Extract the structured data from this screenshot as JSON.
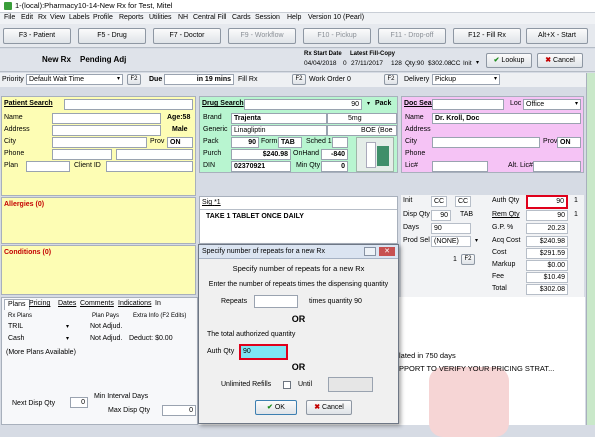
{
  "window": {
    "title": "1-(local):Pharmacy10-14-New Rx for Test, Mitel"
  },
  "menu": [
    "File",
    "Edit",
    "Rx",
    "View",
    "Labels",
    "Profile",
    "Reports",
    "Utilities",
    "NH",
    "Central Fill",
    "Cards",
    "Session",
    "Help",
    "Version 10 (Pearl)"
  ],
  "fkeys": [
    "F3 - Patient",
    "F5 - Drug",
    "F7 - Doctor",
    "F9 - Workflow",
    "F10 - Pickup",
    "F11 - Drop-off",
    "F12 - Fill Rx",
    "Alt+X - Start"
  ],
  "rxbar": {
    "new_rx": "New Rx",
    "pending": "Pending Adj",
    "start_hdr": "Rx Start Date",
    "start_val": "04/04/2018",
    "zero": "0",
    "latest_hdr": "Latest Fill-Copy",
    "latest_val": "27/11/2017",
    "qty_hdr": "128",
    "qty": "Qty:90",
    "amount": "$302.08",
    "cc": "CC",
    "init": "Init",
    "lookup": "Lookup",
    "cancel": "Cancel"
  },
  "row2": {
    "priority_label": "Priority",
    "priority_val": "Default Wait Time",
    "f2": "F2",
    "due_label": "Due",
    "due_val": "in 19 mins",
    "fillrx": "Fill Rx",
    "f2b": "F2",
    "workorder": "Work Order 0",
    "f2c": "F2",
    "delivery_label": "Delivery",
    "delivery_val": "Pickup"
  },
  "patient": {
    "search_label": "Patient Search",
    "name": "Name",
    "age": "Age:58",
    "address": "Address",
    "sex": "Male",
    "city": "City",
    "prov": "Prov",
    "prov_val": "ON",
    "phone": "Phone",
    "plan": "Plan",
    "client_id": "Client ID",
    "allergies": "Allergies (0)",
    "conditions": "Conditions (0)"
  },
  "drug": {
    "search_label": "Drug Search",
    "search_val": "90",
    "pack_label": "Pack",
    "brand_label": "Brand",
    "brand_val": "Trajenta",
    "strength": "5mg",
    "generic_label": "Generic",
    "generic_val": "Linagliptin",
    "boe": "BOE (Boe",
    "pack_row_label": "Pack",
    "pack_val": "90",
    "form_label": "Form",
    "form_val": "TAB",
    "sched": "Sched 1",
    "purch_label": "Purch",
    "purch_val": "$240.98",
    "onhand_label": "OnHand",
    "onhand_val": "-840",
    "din_label": "DIN",
    "din_val": "02370921",
    "minqty_label": "Min Qty",
    "minqty_val": "0",
    "sig_label": "Sig",
    "sig_val": "*1",
    "sig_text": "TAKE 1 TABLET ONCE DAILY"
  },
  "doctor": {
    "search_label": "Doc Search",
    "loc_label": "Loc",
    "loc_val": "Office",
    "name": "Name",
    "name_val": "Dr. Kroll, Doc",
    "address": "Address",
    "city": "City",
    "prov": "Prov",
    "prov_val": "ON",
    "phone": "Phone",
    "lic": "Lic#",
    "alt_lic": "Alt. Lic#"
  },
  "pricing": {
    "init": "Init",
    "init1": "CC",
    "init2": "CC",
    "auth_qty_label": "Auth Qty",
    "auth_qty_val": "90",
    "auth_qty_extra": "1",
    "disp_qty_label": "Disp Qty",
    "disp_qty_val": "90",
    "disp_form": "TAB",
    "rem_qty_label": "Rem Qty",
    "rem_qty_val": "90",
    "rem_extra": "1",
    "days_label": "Days",
    "days_val": "90",
    "gp_label": "G.P. %",
    "gp_val": "20.23",
    "prod_label": "Prod Sel",
    "prod_val": "(NONE)",
    "acq_label": "Acq Cost",
    "acq_val": "$240.98",
    "cost_label": "Cost",
    "cost_val": "$291.59",
    "markup_label": "Markup",
    "markup_val": "$0.00",
    "fee_label": "Fee",
    "fee_val": "$10.49",
    "total_label": "Total",
    "total_val": "$302.08",
    "one": "1",
    "f2": "F2"
  },
  "tabs": [
    "Plans",
    "Pricing",
    "Dates",
    "Comments",
    "Indications",
    "In"
  ],
  "plans": {
    "col1": "Rx Plans",
    "col2": "Plan Pays",
    "col3": "Extra Info (F2 Edits)",
    "rows": [
      {
        "plan": "TRIL",
        "pays": "Not Adjud.",
        "extra": ""
      },
      {
        "plan": "Cash",
        "pays": "Not Adjud.",
        "extra": "Deduct: $0.00"
      }
    ],
    "more": "(More Plans Available)"
  },
  "bottom": {
    "next_disp": "Next Disp Qty",
    "next_disp_val": "0",
    "min_interval": "Min Interval Days",
    "max_disp": "Max Disp Qty",
    "max_disp_val": "0"
  },
  "right_text": {
    "line1": "lated in 750 days",
    "line2": "PPORT TO VERIFY YOUR PRICING STRAT..."
  },
  "dialog": {
    "title": "Specify number of repeats for a new Rx",
    "heading": "Specify number of repeats for a new Rx",
    "instruction": "Enter the number of repeats times the dispensing quantity",
    "repeats_label": "Repeats",
    "times_label": "times quantity 90",
    "or1": "OR",
    "total_label": "The total authorized quantity",
    "auth_label": "Auth Qty",
    "auth_val": "90",
    "or2": "OR",
    "unlimited_label": "Unlimited Refills",
    "until_label": "Until",
    "ok": "OK",
    "cancel": "Cancel"
  },
  "colors": {
    "patient_bg": "#fdfdb4",
    "drug_bg": "#b8f5d0",
    "doctor_bg": "#f5c3f5",
    "highlight": "#e0001b",
    "auth_fill": "#7ee6f5"
  }
}
